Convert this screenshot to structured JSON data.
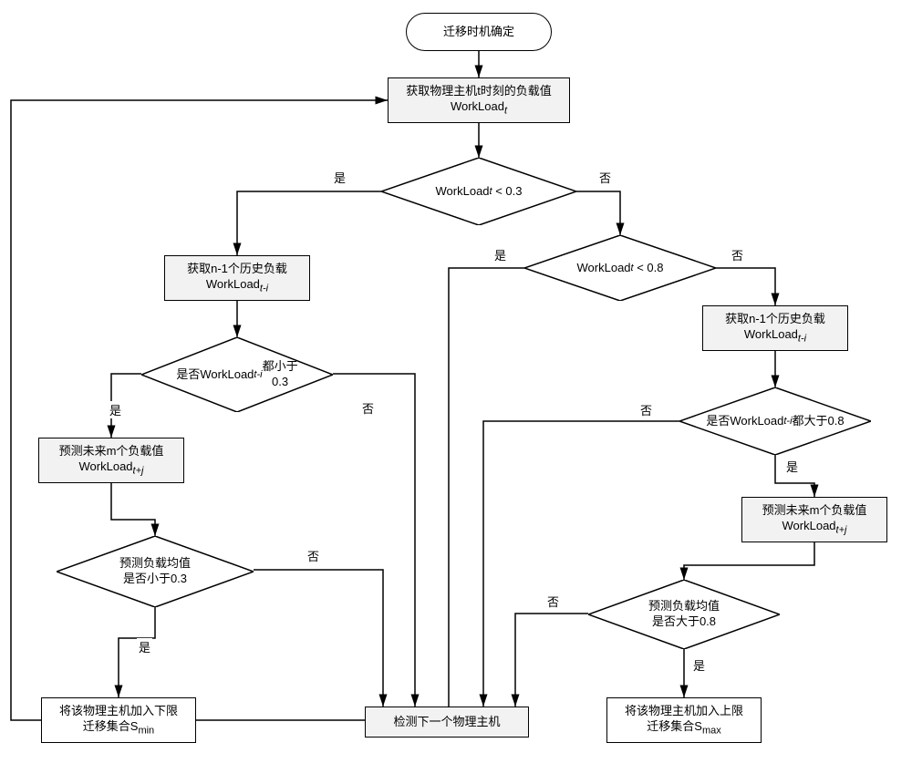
{
  "chart_data": {
    "type": "flowchart",
    "title": "迁移时机确定",
    "nodes": [
      {
        "id": "start",
        "kind": "terminator",
        "label": "迁移时机确定"
      },
      {
        "id": "getWL",
        "kind": "process",
        "label_html": "获取物理主机t时刻的负载值<br>WorkLoad<span class='sub-it'>t</span>"
      },
      {
        "id": "d1",
        "kind": "decision",
        "label_html": "WorkLoad<span class='sub-it'>t</span> < 0.3"
      },
      {
        "id": "d2",
        "kind": "decision",
        "label_html": "WorkLoad<span class='sub-it'>t</span> < 0.8"
      },
      {
        "id": "histL",
        "kind": "process",
        "label_html": "获取n-1个历史负载<br>WorkLoad<span class='sub-it'>t-i</span>"
      },
      {
        "id": "d3",
        "kind": "decision",
        "label_html": "是否WorkLoad<span class='sub-it'>t-i</span>都小于<br>0.3"
      },
      {
        "id": "predL",
        "kind": "process",
        "label_html": "预测未来m个负载值<br>WorkLoad<span class='sub-it'>t+j</span>"
      },
      {
        "id": "d5",
        "kind": "decision",
        "label_html": "预测负载均值<br>是否小于0.3"
      },
      {
        "id": "addMin",
        "kind": "process",
        "label_html": "将该物理主机加入下限<br>迁移集合S<span class='sub'>min</span>"
      },
      {
        "id": "histR",
        "kind": "process",
        "label_html": "获取n-1个历史负载<br>WorkLoad<span class='sub-it'>t-i</span>"
      },
      {
        "id": "d4",
        "kind": "decision",
        "label_html": "是否WorkLoad<span class='sub-it'>t-i</span>都大于0.8"
      },
      {
        "id": "predR",
        "kind": "process",
        "label_html": "预测未来m个负载值<br>WorkLoad<span class='sub-it'>t+j</span>"
      },
      {
        "id": "d6",
        "kind": "decision",
        "label_html": "预测负载均值<br>是否大于0.8"
      },
      {
        "id": "addMax",
        "kind": "process",
        "label_html": "将该物理主机加入上限<br>迁移集合S<span class='sub'>max</span>"
      },
      {
        "id": "next",
        "kind": "process",
        "label_html": "检测下一个物理主机"
      }
    ],
    "edges": [
      {
        "from": "start",
        "to": "getWL"
      },
      {
        "from": "getWL",
        "to": "d1"
      },
      {
        "from": "d1",
        "to": "histL",
        "label": "是"
      },
      {
        "from": "d1",
        "to": "d2",
        "label": "否"
      },
      {
        "from": "d2",
        "to": "next",
        "label": "是"
      },
      {
        "from": "d2",
        "to": "histR",
        "label": "否"
      },
      {
        "from": "histL",
        "to": "d3"
      },
      {
        "from": "d3",
        "to": "predL",
        "label": "是"
      },
      {
        "from": "d3",
        "to": "next",
        "label": "否"
      },
      {
        "from": "predL",
        "to": "d5"
      },
      {
        "from": "d5",
        "to": "addMin",
        "label": "是"
      },
      {
        "from": "d5",
        "to": "next",
        "label": "否"
      },
      {
        "from": "histR",
        "to": "d4"
      },
      {
        "from": "d4",
        "to": "predR",
        "label": "是"
      },
      {
        "from": "d4",
        "to": "next",
        "label": "否"
      },
      {
        "from": "predR",
        "to": "d6"
      },
      {
        "from": "d6",
        "to": "addMax",
        "label": "是"
      },
      {
        "from": "d6",
        "to": "next",
        "label": "否"
      },
      {
        "from": "next",
        "to": "getWL",
        "back_edge": true
      }
    ],
    "edge_labels": {
      "yes": "是",
      "no": "否"
    }
  }
}
